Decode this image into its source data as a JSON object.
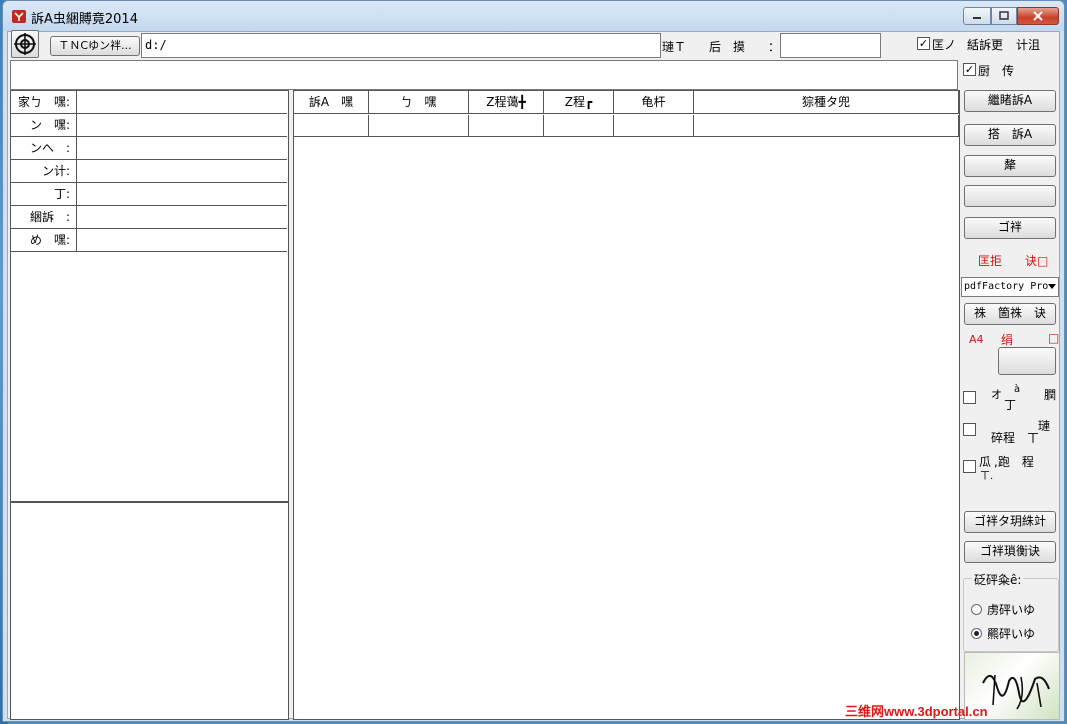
{
  "window": {
    "title": "訴A虫綑賻竟2014"
  },
  "toolbar": {
    "target_button": "ＴＮCゆン袢...",
    "path_value": "d:/",
    "field_label_1": "璉Ｔ",
    "field_label_2": "后　摸",
    "field_colon": "：",
    "field_value": "",
    "check1_label": "匡ノ",
    "link1": "絬訴更",
    "link2": "计沮"
  },
  "second_row": {
    "check2_label": "厨　传"
  },
  "left_grid": {
    "rows": [
      {
        "label": "家ㄅ　嘿:",
        "value": ""
      },
      {
        "label": "ン　嘿:",
        "value": ""
      },
      {
        "label": "ンへ　:",
        "value": ""
      },
      {
        "label": "ン计:",
        "value": ""
      },
      {
        "label": "丁:",
        "value": ""
      },
      {
        "label": "綑訴　:",
        "value": ""
      },
      {
        "label": "め　嘿:",
        "value": ""
      }
    ]
  },
  "table": {
    "headers": [
      "訴A　嘿",
      "ㄅ　嘿",
      "Z程蔼╋",
      "Z程┏",
      "龟杆",
      "猔種タ兜"
    ]
  },
  "right_panel": {
    "btn1": "繼睹訴A",
    "btn2": "搭　訴A",
    "btn3": "犛",
    "btn4": "",
    "btn5": "ゴ袢",
    "red_label1": "匡拒",
    "red_label2": "诀□",
    "printer": "pdfFactory Pro",
    "btn6": "祩　箇祩　诀",
    "paper_label": "A4",
    "red_label3": "绢",
    "red_square": "□",
    "btn7": "",
    "opt1_a": "オ",
    "opt1_b": "丁",
    "opt1_c": "à",
    "opt1_d": "膶",
    "opt2_a": "碎程",
    "opt2_b": "ㄒ",
    "opt2_c": "璉",
    "opt3_a": "瓜",
    "opt3_b": "ㄒ.",
    "opt3_c": ",跑　程",
    "btn8": "ゴ袢タ玥絑竍",
    "btn9": "ゴ袢瑣衡诀",
    "group_title": "砭砰粂ê:",
    "radio1": "虏砰いゆ",
    "radio2": "羆砰いゆ"
  },
  "watermark": {
    "text": "三维网www.3dportal.cn"
  }
}
